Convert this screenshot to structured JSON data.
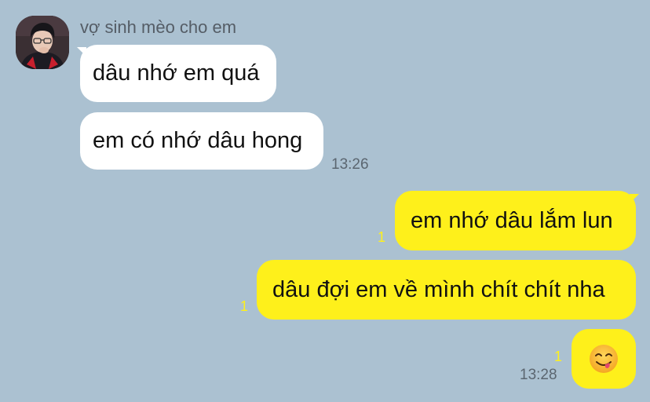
{
  "chat": {
    "sender_name": "vợ sinh mèo cho em",
    "incoming": [
      {
        "text": "dâu nhớ em quá"
      },
      {
        "text": "em có nhớ dâu hong"
      }
    ],
    "incoming_time": "13:26",
    "outgoing": [
      {
        "text": "em nhớ dâu lắm lun",
        "unread": "1"
      },
      {
        "text": "dâu đợi em về mình chít chít nha",
        "unread": "1"
      }
    ],
    "sticker": {
      "icon": "savoring-food-emoji-icon",
      "unread": "1"
    },
    "outgoing_time": "13:28"
  },
  "colors": {
    "background": "#abc1d1",
    "incoming_bubble": "#ffffff",
    "outgoing_bubble": "#fef01b",
    "unread_count": "#fef01b",
    "timestamp": "#5b6670"
  }
}
